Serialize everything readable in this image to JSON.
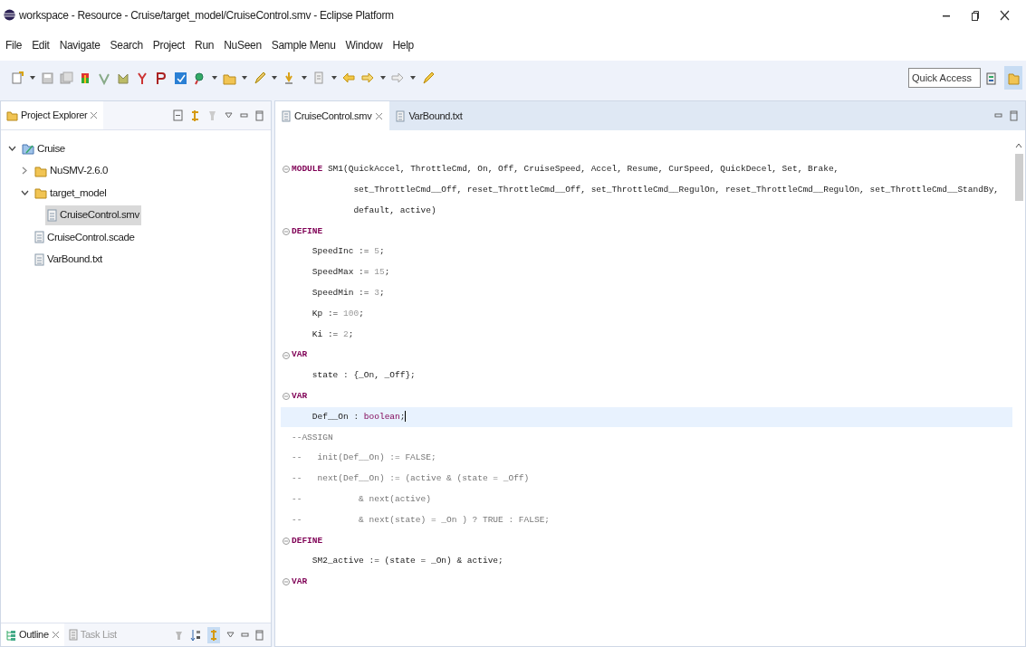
{
  "window": {
    "title": "workspace - Resource - Cruise/target_model/CruiseControl.smv - Eclipse Platform"
  },
  "menu": [
    "File",
    "Edit",
    "Navigate",
    "Search",
    "Project",
    "Run",
    "NuSeen",
    "Sample Menu",
    "Window",
    "Help"
  ],
  "quick_access": {
    "placeholder": "Quick Access"
  },
  "project_explorer": {
    "title": "Project Explorer",
    "tree": [
      {
        "label": "Cruise",
        "kind": "project",
        "expanded": true,
        "selected": false,
        "children": [
          {
            "label": "NuSMV-2.6.0",
            "kind": "folder",
            "expanded": false,
            "selected": false
          },
          {
            "label": "target_model",
            "kind": "folder",
            "expanded": true,
            "selected": false,
            "children": [
              {
                "label": "CruiseControl.smv",
                "kind": "file",
                "selected": true
              }
            ]
          },
          {
            "label": "CruiseControl.scade",
            "kind": "file",
            "selected": false
          },
          {
            "label": "VarBound.txt",
            "kind": "file",
            "selected": false
          }
        ]
      }
    ]
  },
  "bottom_tabs": [
    {
      "label": "Outline",
      "kind": "outline",
      "selected": true
    },
    {
      "label": "Task List",
      "kind": "tasks",
      "selected": false
    }
  ],
  "editor_tabs": [
    {
      "label": "CruiseControl.smv",
      "selected": true
    },
    {
      "label": "VarBound.txt",
      "selected": false
    }
  ],
  "code": [
    {
      "fold": true,
      "current": false,
      "segments": [
        {
          "kind": "keyword",
          "text": "MODULE"
        },
        {
          "kind": "plain",
          "text": " SM1(QuickAccel, ThrottleCmd, On, Off, CruiseSpeed, Accel, Resume, CurSpeed, QuickDecel, Set, Brake,"
        }
      ]
    },
    {
      "fold": false,
      "current": false,
      "segments": [
        {
          "kind": "plain",
          "text": "            set_ThrottleCmd__Off, reset_ThrottleCmd__Off, set_ThrottleCmd__RegulOn, reset_ThrottleCmd__RegulOn, set_ThrottleCmd__StandBy,"
        }
      ]
    },
    {
      "fold": false,
      "current": false,
      "segments": [
        {
          "kind": "plain",
          "text": "            default, active)"
        }
      ]
    },
    {
      "fold": true,
      "current": false,
      "segments": [
        {
          "kind": "keyword",
          "text": "DEFINE"
        }
      ]
    },
    {
      "fold": false,
      "current": false,
      "segments": [
        {
          "kind": "plain",
          "text": "    SpeedInc := "
        },
        {
          "kind": "number",
          "text": "5"
        },
        {
          "kind": "plain",
          "text": ";"
        }
      ]
    },
    {
      "fold": false,
      "current": false,
      "segments": [
        {
          "kind": "plain",
          "text": "    SpeedMax := "
        },
        {
          "kind": "number",
          "text": "15"
        },
        {
          "kind": "plain",
          "text": ";"
        }
      ]
    },
    {
      "fold": false,
      "current": false,
      "segments": [
        {
          "kind": "plain",
          "text": "    SpeedMin := "
        },
        {
          "kind": "number",
          "text": "3"
        },
        {
          "kind": "plain",
          "text": ";"
        }
      ]
    },
    {
      "fold": false,
      "current": false,
      "segments": [
        {
          "kind": "plain",
          "text": "    Kp := "
        },
        {
          "kind": "number",
          "text": "100"
        },
        {
          "kind": "plain",
          "text": ";"
        }
      ]
    },
    {
      "fold": false,
      "current": false,
      "segments": [
        {
          "kind": "plain",
          "text": "    Ki := "
        },
        {
          "kind": "number",
          "text": "2"
        },
        {
          "kind": "plain",
          "text": ";"
        }
      ]
    },
    {
      "fold": true,
      "current": false,
      "segments": [
        {
          "kind": "keyword",
          "text": "VAR"
        }
      ]
    },
    {
      "fold": false,
      "current": false,
      "segments": [
        {
          "kind": "plain",
          "text": "    state : {_On, _Off};"
        }
      ]
    },
    {
      "fold": true,
      "current": false,
      "segments": [
        {
          "kind": "keyword",
          "text": "VAR"
        }
      ]
    },
    {
      "fold": false,
      "current": true,
      "segments": [
        {
          "kind": "plain",
          "text": "    Def__On : "
        },
        {
          "kind": "type",
          "text": "boolean"
        },
        {
          "kind": "plain",
          "text": ";"
        }
      ]
    },
    {
      "fold": false,
      "current": false,
      "segments": [
        {
          "kind": "comment",
          "text": "--ASSIGN"
        }
      ]
    },
    {
      "fold": false,
      "current": false,
      "segments": [
        {
          "kind": "comment",
          "text": "--   init(Def__On) := FALSE;"
        }
      ]
    },
    {
      "fold": false,
      "current": false,
      "segments": [
        {
          "kind": "comment",
          "text": "--   next(Def__On) := (active & (state = _Off)"
        }
      ]
    },
    {
      "fold": false,
      "current": false,
      "segments": [
        {
          "kind": "comment",
          "text": "--           & next(active)"
        }
      ]
    },
    {
      "fold": false,
      "current": false,
      "segments": [
        {
          "kind": "comment",
          "text": "--           & next(state) = _On ) ? TRUE : FALSE;"
        }
      ]
    },
    {
      "fold": true,
      "current": false,
      "segments": [
        {
          "kind": "keyword",
          "text": "DEFINE"
        }
      ]
    },
    {
      "fold": false,
      "current": false,
      "segments": [
        {
          "kind": "plain",
          "text": "    SM2_active := (state = _On) & active;"
        }
      ]
    },
    {
      "fold": true,
      "current": false,
      "segments": [
        {
          "kind": "keyword",
          "text": "VAR"
        }
      ]
    }
  ]
}
